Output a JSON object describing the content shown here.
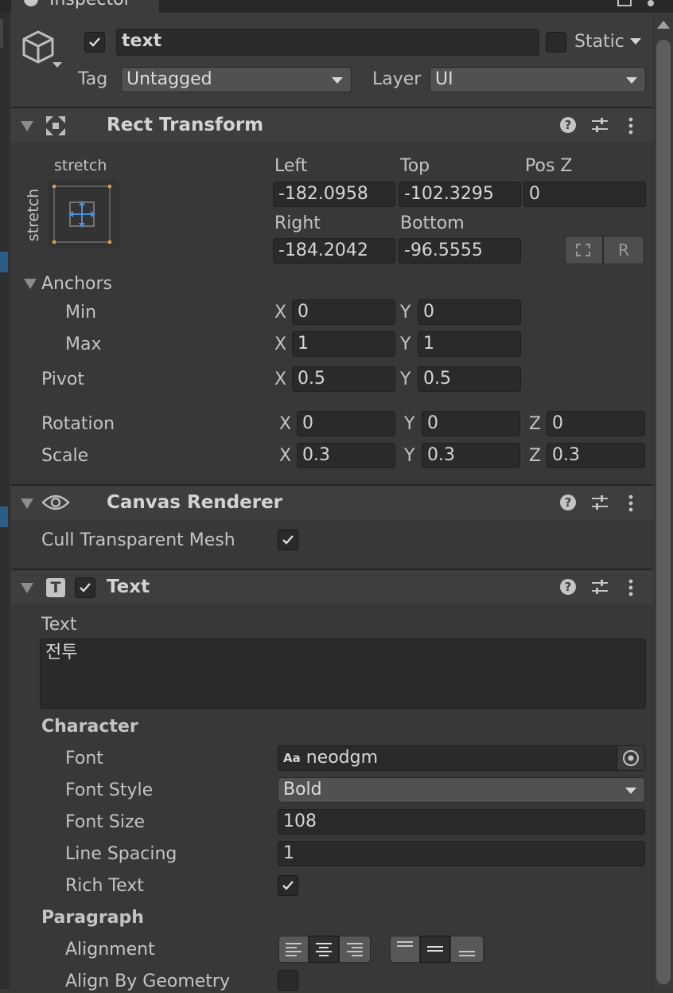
{
  "window": {
    "tab_title": "Inspector"
  },
  "object": {
    "name": "text",
    "static_label": "Static",
    "tag_label": "Tag",
    "tag_value": "Untagged",
    "layer_label": "Layer",
    "layer_value": "UI"
  },
  "rect_transform": {
    "title": "Rect Transform",
    "anchor_preset_h": "stretch",
    "anchor_preset_v": "stretch",
    "left_label": "Left",
    "left": "-182.0958",
    "top_label": "Top",
    "top": "-102.3295",
    "posz_label": "Pos Z",
    "posz": "0",
    "right_label": "Right",
    "right": "-184.2042",
    "bottom_label": "Bottom",
    "bottom": "-96.5555",
    "r_button": "R",
    "anchors_label": "Anchors",
    "min_label": "Min",
    "min_x": "0",
    "min_y": "0",
    "max_label": "Max",
    "max_x": "1",
    "max_y": "1",
    "pivot_label": "Pivot",
    "pivot_x": "0.5",
    "pivot_y": "0.5",
    "rotation_label": "Rotation",
    "rot_x": "0",
    "rot_y": "0",
    "rot_z": "0",
    "scale_label": "Scale",
    "scale_x": "0.3",
    "scale_y": "0.3",
    "scale_z": "0.3",
    "axis_x": "X",
    "axis_y": "Y",
    "axis_z": "Z"
  },
  "canvas_renderer": {
    "title": "Canvas Renderer",
    "cull_label": "Cull Transparent Mesh"
  },
  "text_component": {
    "title": "Text",
    "text_label": "Text",
    "text_value": "전투",
    "character_label": "Character",
    "font_label": "Font",
    "font_value": "neodgm",
    "font_prefix": "Aa",
    "font_style_label": "Font Style",
    "font_style_value": "Bold",
    "font_size_label": "Font Size",
    "font_size_value": "108",
    "line_spacing_label": "Line Spacing",
    "line_spacing_value": "1",
    "rich_text_label": "Rich Text",
    "paragraph_label": "Paragraph",
    "alignment_label": "Alignment",
    "align_by_geometry_label": "Align By Geometry"
  },
  "icons": [
    "info-icon",
    "cube-icon",
    "anchor-move-icon",
    "eye-icon",
    "text-t-icon",
    "help-icon",
    "preset-sliders-icon",
    "kebab-menu-icon",
    "object-picker-icon"
  ],
  "colors": {
    "background": "#383838",
    "field": "#2a2a2a",
    "header": "#3e3e3e",
    "accent_blue": "#4a90d9",
    "anchor_orange": "#d9a23b"
  }
}
